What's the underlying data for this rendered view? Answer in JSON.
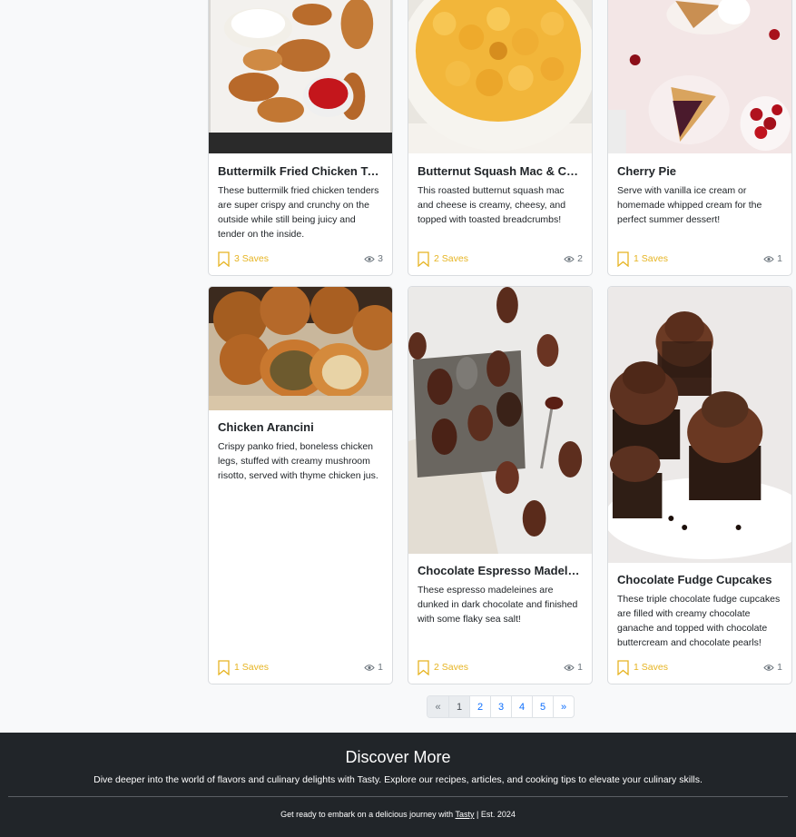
{
  "cards": [
    {
      "title": "Buttermilk Fried Chicken Te...",
      "description": "These buttermilk fried chicken tenders are super crispy and crunchy on the outside while still being juicy and tender on the inside.",
      "saves": "3 Saves",
      "views": "3"
    },
    {
      "title": "Butternut Squash Mac & Ch...",
      "description": "This roasted butternut squash mac and cheese is creamy, cheesy, and topped with toasted breadcrumbs!",
      "saves": "2 Saves",
      "views": "2"
    },
    {
      "title": "Cherry Pie",
      "description": "Serve with vanilla ice cream or homemade whipped cream for the perfect summer dessert!",
      "saves": "1 Saves",
      "views": "1"
    },
    {
      "title": "Chicken Arancini",
      "description": "Crispy panko fried, boneless chicken legs, stuffed with creamy mushroom risotto, served with thyme chicken jus.",
      "saves": "1 Saves",
      "views": "1"
    },
    {
      "title": "Chocolate Espresso Madelei...",
      "description": "These espresso madeleines are dunked in dark chocolate and finished with some flaky sea salt!",
      "saves": "2 Saves",
      "views": "1"
    },
    {
      "title": "Chocolate Fudge Cupcakes",
      "description": "These triple chocolate fudge cupcakes are filled with creamy chocolate ganache and topped with chocolate buttercream and chocolate pearls!",
      "saves": "1 Saves",
      "views": "1"
    }
  ],
  "pagination": {
    "prev": "«",
    "pages": [
      "1",
      "2",
      "3",
      "4",
      "5"
    ],
    "next": "»",
    "active": "1"
  },
  "footer": {
    "heading": "Discover More",
    "tagline": "Dive deeper into the world of flavors and culinary delights with Tasty. Explore our recipes, articles, and cooking tips to elevate your culinary skills.",
    "copy_prefix": "Get ready to embark on a delicious journey with ",
    "brand_link": "Tasty",
    "copy_suffix": " | Est. 2024"
  },
  "colors": {
    "accent_saves": "#e6b422",
    "link": "#0d6efd",
    "footer_bg": "#212529"
  },
  "icons": {
    "save": "bookmark-icon",
    "views": "eye-icon"
  }
}
